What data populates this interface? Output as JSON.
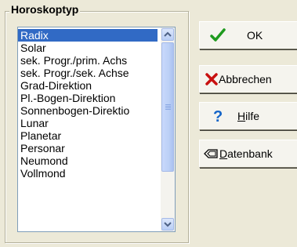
{
  "group": {
    "title": "Horoskoptyp"
  },
  "list": {
    "items": [
      "Radix",
      "Solar",
      "sek. Progr./prim. Achs",
      "sek. Progr./sek. Achse",
      "Grad-Direktion",
      "Pl.-Bogen-Direktion",
      "Sonnenbogen-Direktio",
      "Lunar",
      "Planetar",
      "Personar",
      "Neumond",
      "Vollmond"
    ],
    "selected_index": 0
  },
  "buttons": {
    "ok": {
      "label": "OK",
      "icon": "checkmark-icon"
    },
    "cancel": {
      "label": "Abbrechen",
      "icon": "x-icon"
    },
    "help": {
      "label_mnemonic": "H",
      "label_rest": "ilfe",
      "icon": "question-icon"
    },
    "database": {
      "label_mnemonic": "D",
      "label_rest": "atenbank",
      "icon": "tag-icon"
    }
  },
  "colors": {
    "selection": "#316ac5",
    "check": "#1e9a1e",
    "cross": "#c81010",
    "question": "#1464c8"
  }
}
